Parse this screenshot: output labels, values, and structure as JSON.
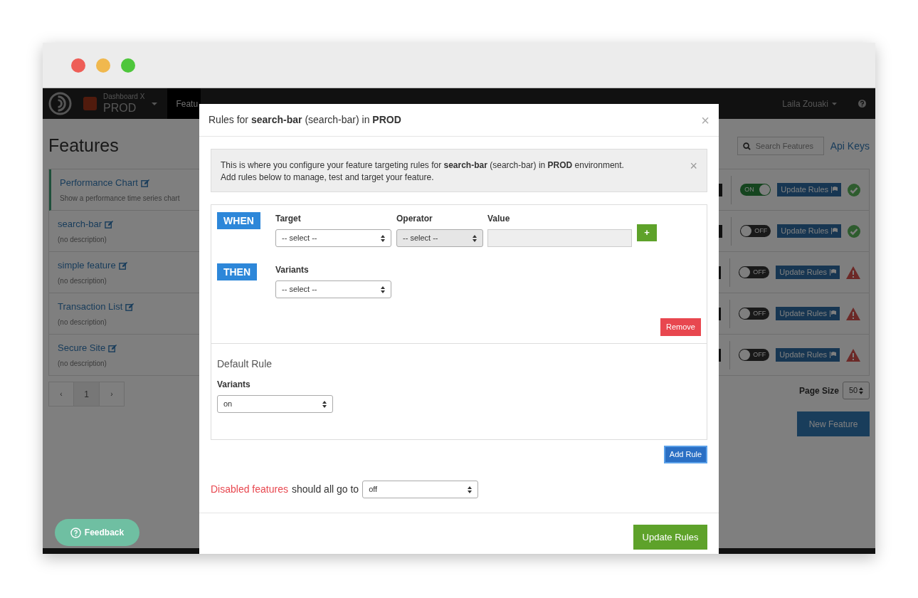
{
  "nav": {
    "org": "Dashboard X",
    "env": "PROD",
    "tabs": [
      {
        "label": "Featu",
        "selected": true
      }
    ],
    "user": "Laila Zouaki"
  },
  "page": {
    "title": "Features",
    "search": {
      "placeholder": "Search Features"
    },
    "api_keys": "Api Keys",
    "features": [
      {
        "name": "Performance Chart",
        "description": "Show a performance time series chart",
        "selected": true,
        "on": true,
        "toggle": "ON",
        "button": "Update Rules",
        "warning": false
      },
      {
        "name": "search-bar",
        "description": "(no description)",
        "selected": false,
        "on": false,
        "toggle": "OFF",
        "button": "Update Rules",
        "warning": false
      },
      {
        "name": "simple feature",
        "description": "(no description)",
        "selected": false,
        "on": false,
        "toggle": "OFF",
        "button": "Update Rules",
        "warning": true
      },
      {
        "name": "Transaction List",
        "description": "(no description)",
        "selected": false,
        "on": false,
        "toggle": "OFF",
        "button": "Update Rules",
        "warning": true
      },
      {
        "name": "Secure Site",
        "description": "(no description)",
        "selected": false,
        "on": false,
        "toggle": "OFF",
        "button": "Update Rules",
        "warning": true
      }
    ],
    "pagination": {
      "prev": "‹",
      "page": "1",
      "next": "›"
    },
    "page_size_label": "Page Size",
    "page_size": "50",
    "new_feature": "New Feature",
    "feedback": "Feedback"
  },
  "modal": {
    "title": "Rules for **search-bar** (search-bar) in **PROD**",
    "close": "×",
    "alert": "This is where you configure your feature targeting rules for **search-bar** (search-bar) in **PROD** environment.",
    "alert2": "Add rules below to manage, test and target your feature.",
    "alert_close": "×",
    "when": "WHEN",
    "then": "THEN",
    "target_label": "Target",
    "operator_label": "Operator",
    "value_label": "Value",
    "target": "-- select --",
    "operator": {
      "value": "-- select --",
      "disabled": true
    },
    "add_condition": "+",
    "variants_label": "Variants",
    "variants": "-- select --",
    "remove": "Remove",
    "default_rule": "Default Rule",
    "default_variants_label": "Variants",
    "default_variant": "on",
    "add_rule": "Add Rule",
    "disabled_link": "Disabled features",
    "disabled_text": "should all go to",
    "disabled_value": "off",
    "submit": "Update Rules"
  }
}
